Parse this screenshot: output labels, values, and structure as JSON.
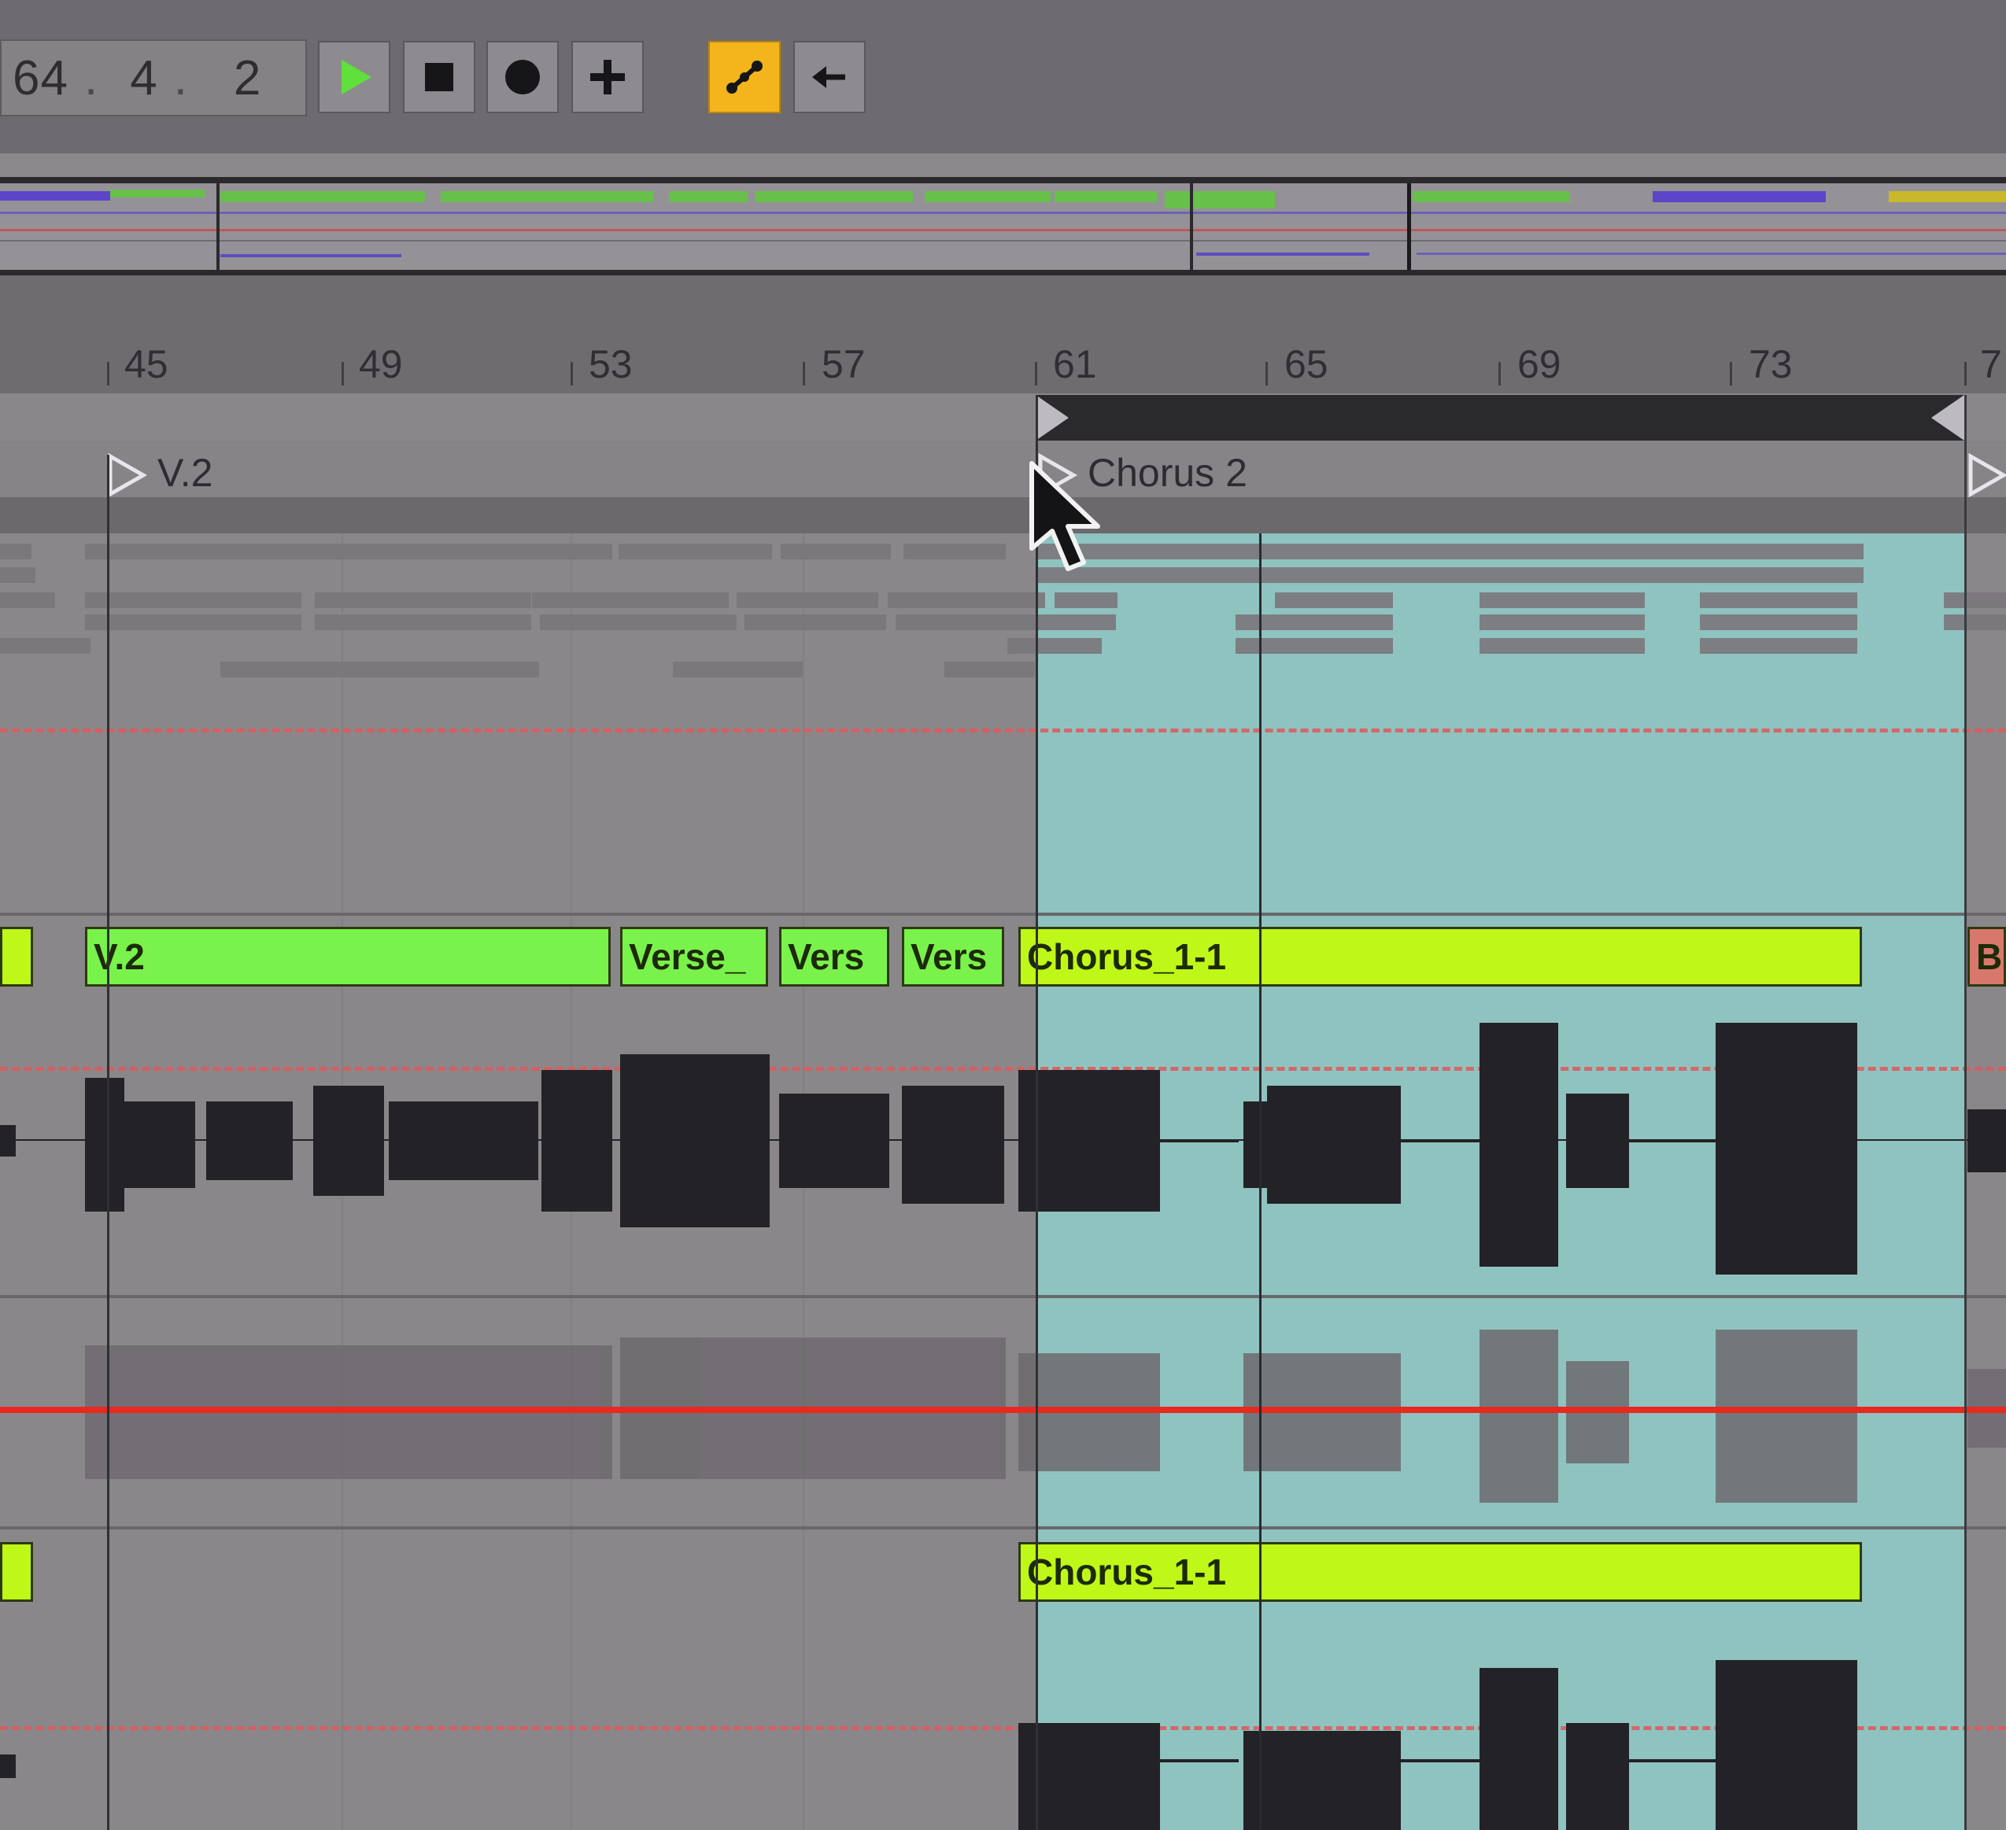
{
  "transport": {
    "position": {
      "bars": "64",
      "beats": "4",
      "sixteenths": "2"
    },
    "buttons": [
      {
        "name": "play-button",
        "icon": "play-icon",
        "state": "inactive"
      },
      {
        "name": "stop-button",
        "icon": "stop-icon",
        "state": "inactive"
      },
      {
        "name": "record-button",
        "icon": "record-icon",
        "state": "inactive"
      },
      {
        "name": "add-button",
        "icon": "plus-icon",
        "state": "inactive"
      },
      {
        "name": "automation-arm-button",
        "icon": "automation-icon",
        "state": "active"
      },
      {
        "name": "back-to-arrangement-button",
        "icon": "arrow-left-icon",
        "state": "inactive"
      }
    ]
  },
  "ruler": {
    "bars": [
      "45",
      "49",
      "53",
      "57",
      "61",
      "65",
      "69",
      "73",
      "7"
    ]
  },
  "locators": {
    "v2": "V.2",
    "chorus2": "Chorus 2"
  },
  "track1": {
    "clips": {
      "c1": "V.2",
      "c2": "Verse_",
      "c3": "Vers",
      "c4": "Vers",
      "c5": "Chorus_1-1",
      "c6": "B"
    }
  },
  "track2": {
    "clips": {
      "c1": "Chorus_1-1"
    }
  },
  "colors": {
    "selection": "#8fc3c0",
    "clip_green": "#7af24c",
    "clip_lime": "#bff818",
    "clip_salmon": "#d8786c",
    "automation_red": "#e0595a",
    "automation_arm": "#f3b51b"
  }
}
